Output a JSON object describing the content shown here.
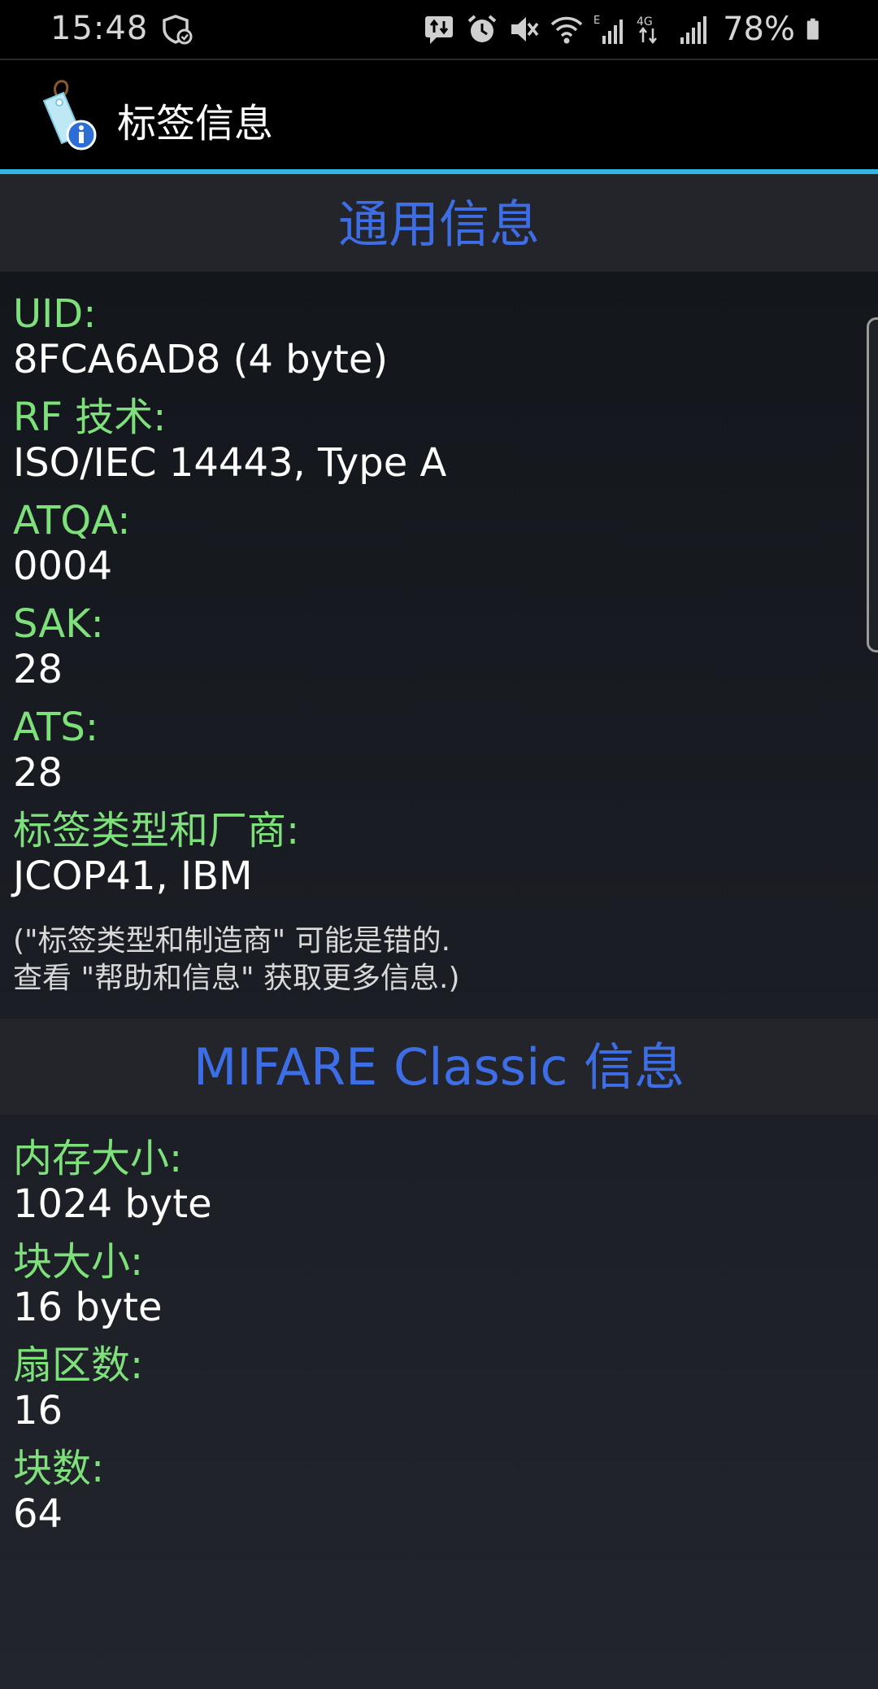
{
  "status_bar": {
    "time": "15:48",
    "battery_percent": "78%",
    "icons": [
      "shield-check-icon",
      "data-transfer-icon",
      "alarm-icon",
      "mute-icon",
      "wifi-icon",
      "signal-e-icon",
      "network-4g-icon",
      "signal-bars-icon",
      "battery-icon"
    ]
  },
  "app_bar": {
    "title": "标签信息",
    "icon": "tag-info-icon"
  },
  "general_section": {
    "title": "通用信息",
    "fields": [
      {
        "label": "UID:",
        "value": "8FCA6AD8 (4 byte)"
      },
      {
        "label": "RF 技术:",
        "value": "ISO/IEC 14443, Type A"
      },
      {
        "label": "ATQA:",
        "value": "0004"
      },
      {
        "label": "SAK:",
        "value": "28"
      },
      {
        "label": "ATS:",
        "value": "28"
      },
      {
        "label": "标签类型和厂商:",
        "value": "JCOP41, IBM"
      }
    ],
    "note_line1": "(\"标签类型和制造商\" 可能是错的.",
    "note_line2": "查看 \"帮助和信息\" 获取更多信息.)"
  },
  "mifare_section": {
    "title": "MIFARE Classic 信息",
    "fields": [
      {
        "label": "内存大小:",
        "value": "1024 byte"
      },
      {
        "label": "块大小:",
        "value": "16 byte"
      },
      {
        "label": "扇区数:",
        "value": "16"
      },
      {
        "label": "块数:",
        "value": "64"
      }
    ]
  },
  "colors": {
    "accent_line": "#33b5e5",
    "section_title": "#3d6ee6",
    "label": "#7ee07a",
    "value": "#ffffff"
  }
}
